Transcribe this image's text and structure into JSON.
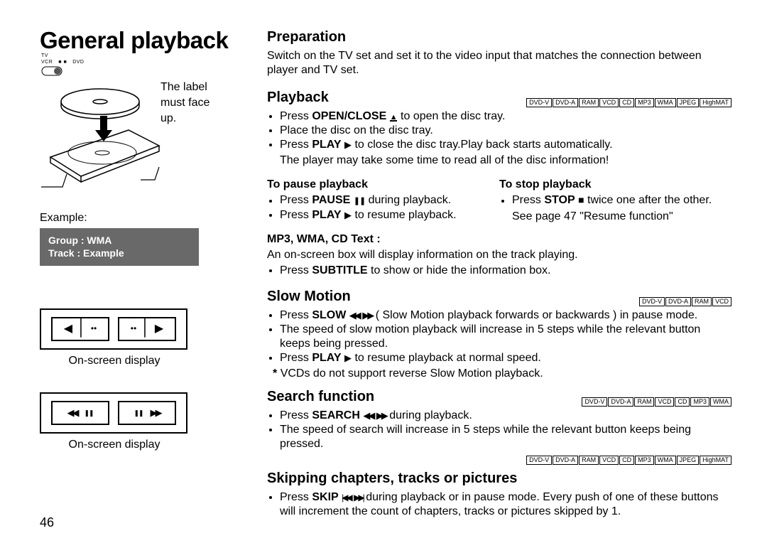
{
  "page_number": "46",
  "title": "General playback",
  "device_icon": {
    "tv": "TV",
    "vcr": "VCR",
    "dvd": "DVD"
  },
  "label_up": {
    "l1": "The label",
    "l2": "must face",
    "l3": "up."
  },
  "example_label": "Example:",
  "info_box": {
    "l1": "Group : WMA",
    "l2": "Track  : Example"
  },
  "osd_caption": "On-screen display",
  "preparation": {
    "heading": "Preparation",
    "text": "Switch on the TV set and set it to the video input that matches the connection between player and TV set."
  },
  "playback": {
    "heading": "Playback",
    "formats": [
      "DVD-V",
      "DVD-A",
      "RAM",
      "VCD",
      "CD",
      "MP3",
      "WMA",
      "JPEG",
      "HighMAT"
    ],
    "b1_pre": "Press ",
    "b1_b": "OPEN/CLOSE",
    "b1_post": " to open the disc tray.",
    "b2": "Place the disc on the disc tray.",
    "b3_pre": "Press ",
    "b3_b": "PLAY",
    "b3_post": " to close the disc tray.Play back starts automatically.",
    "note": "The player may take some time to read all of the disc information!",
    "pause_head": "To pause playback",
    "pause_b1_pre": "Press ",
    "pause_b1_b": "PAUSE",
    "pause_b1_post": " during playback.",
    "pause_b2_pre": "Press ",
    "pause_b2_b": "PLAY",
    "pause_b2_post": "  to resume playback.",
    "stop_head": "To stop playback",
    "stop_b1_pre": "Press ",
    "stop_b1_b": "STOP",
    "stop_b1_post": "  twice one after the other.",
    "stop_b2": "See page 47 \"Resume function\"",
    "mp3_head": "MP3, WMA, CD Text :",
    "mp3_text": "An on-screen box will display information on the track playing.",
    "mp3_b1_pre": "Press ",
    "mp3_b1_b": "SUBTITLE",
    "mp3_b1_post": " to show or hide the information box."
  },
  "slow": {
    "heading": "Slow Motion",
    "formats": [
      "DVD-V",
      "DVD-A",
      "RAM",
      "VCD"
    ],
    "b1_pre": "Press ",
    "b1_b": "SLOW",
    "b1_post": " ( Slow Motion playback forwards or backwards ) in pause mode.",
    "b2": "The speed of slow motion playback will increase in 5 steps while the relevant button keeps being pressed.",
    "b3_pre": "Press ",
    "b3_b": "PLAY",
    "b3_post": " to resume playback at normal speed.",
    "star": "VCDs do not support reverse Slow Motion playback."
  },
  "search": {
    "heading": "Search function",
    "formats": [
      "DVD-V",
      "DVD-A",
      "RAM",
      "VCD",
      "CD",
      "MP3",
      "WMA"
    ],
    "b1_pre": "Press ",
    "b1_b": "SEARCH",
    "b1_post": " during playback.",
    "b2": "The speed of search will increase in 5 steps while the relevant button keeps being pressed."
  },
  "skipping": {
    "heading": "Skipping chapters, tracks or pictures",
    "formats": [
      "DVD-V",
      "DVD-A",
      "RAM",
      "VCD",
      "CD",
      "MP3",
      "WMA",
      "JPEG",
      "HighMAT"
    ],
    "b1_pre": "Press ",
    "b1_b": "SKIP",
    "b1_post": "  during playback or in pause mode. Every push of one of these buttons will increment the count of chapters, tracks or pictures skipped by 1."
  }
}
